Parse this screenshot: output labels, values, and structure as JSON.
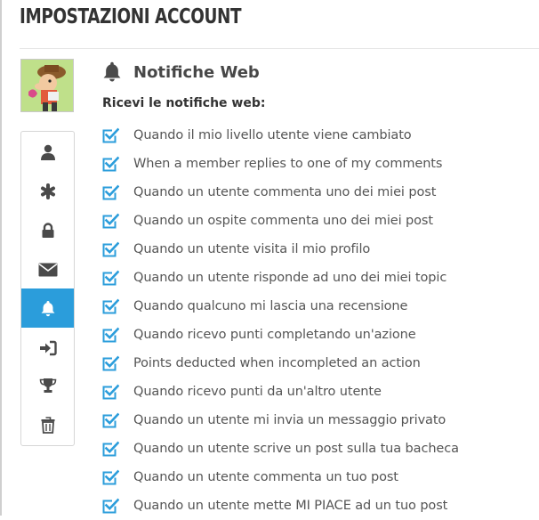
{
  "page": {
    "title": "IMPOSTAZIONI ACCOUNT"
  },
  "sidebar": {
    "items": [
      {
        "icon": "user-icon",
        "active": false
      },
      {
        "icon": "asterisk-icon",
        "active": false
      },
      {
        "icon": "lock-icon",
        "active": false
      },
      {
        "icon": "envelope-icon",
        "active": false
      },
      {
        "icon": "bell-icon",
        "active": true
      },
      {
        "icon": "sign-in-icon",
        "active": false
      },
      {
        "icon": "trophy-icon",
        "active": false
      },
      {
        "icon": "trash-icon",
        "active": false
      }
    ]
  },
  "main": {
    "section_title": "Notifiche Web",
    "section_icon": "bell-icon",
    "subheading": "Ricevi le notifiche web:",
    "options": [
      {
        "label": "Quando il mio livello utente viene cambiato",
        "checked": true
      },
      {
        "label": "When a member replies to one of my comments",
        "checked": true
      },
      {
        "label": "Quando un utente commenta uno dei miei post",
        "checked": true
      },
      {
        "label": "Quando un ospite commenta uno dei miei post",
        "checked": true
      },
      {
        "label": "Quando un utente visita il mio profilo",
        "checked": true
      },
      {
        "label": "Quando un utente risponde ad uno dei miei topic",
        "checked": true
      },
      {
        "label": "Quando qualcuno mi lascia una recensione",
        "checked": true
      },
      {
        "label": "Quando ricevo punti completando un'azione",
        "checked": true
      },
      {
        "label": "Points deducted when incompleted an action",
        "checked": true
      },
      {
        "label": "Quando ricevo punti da un'altro utente",
        "checked": true
      },
      {
        "label": "Quando un utente mi invia un messaggio privato",
        "checked": true
      },
      {
        "label": "Quando un utente scrive un post sulla tua bacheca",
        "checked": true
      },
      {
        "label": "Quando un utente commenta un tuo post",
        "checked": true
      },
      {
        "label": "Quando un utente mette MI PIACE ad un tuo post",
        "checked": true
      }
    ]
  },
  "colors": {
    "accent": "#2b9ddb",
    "checkbox": "#2b9ddb",
    "icon": "#4a4a4a",
    "text": "#555555"
  }
}
